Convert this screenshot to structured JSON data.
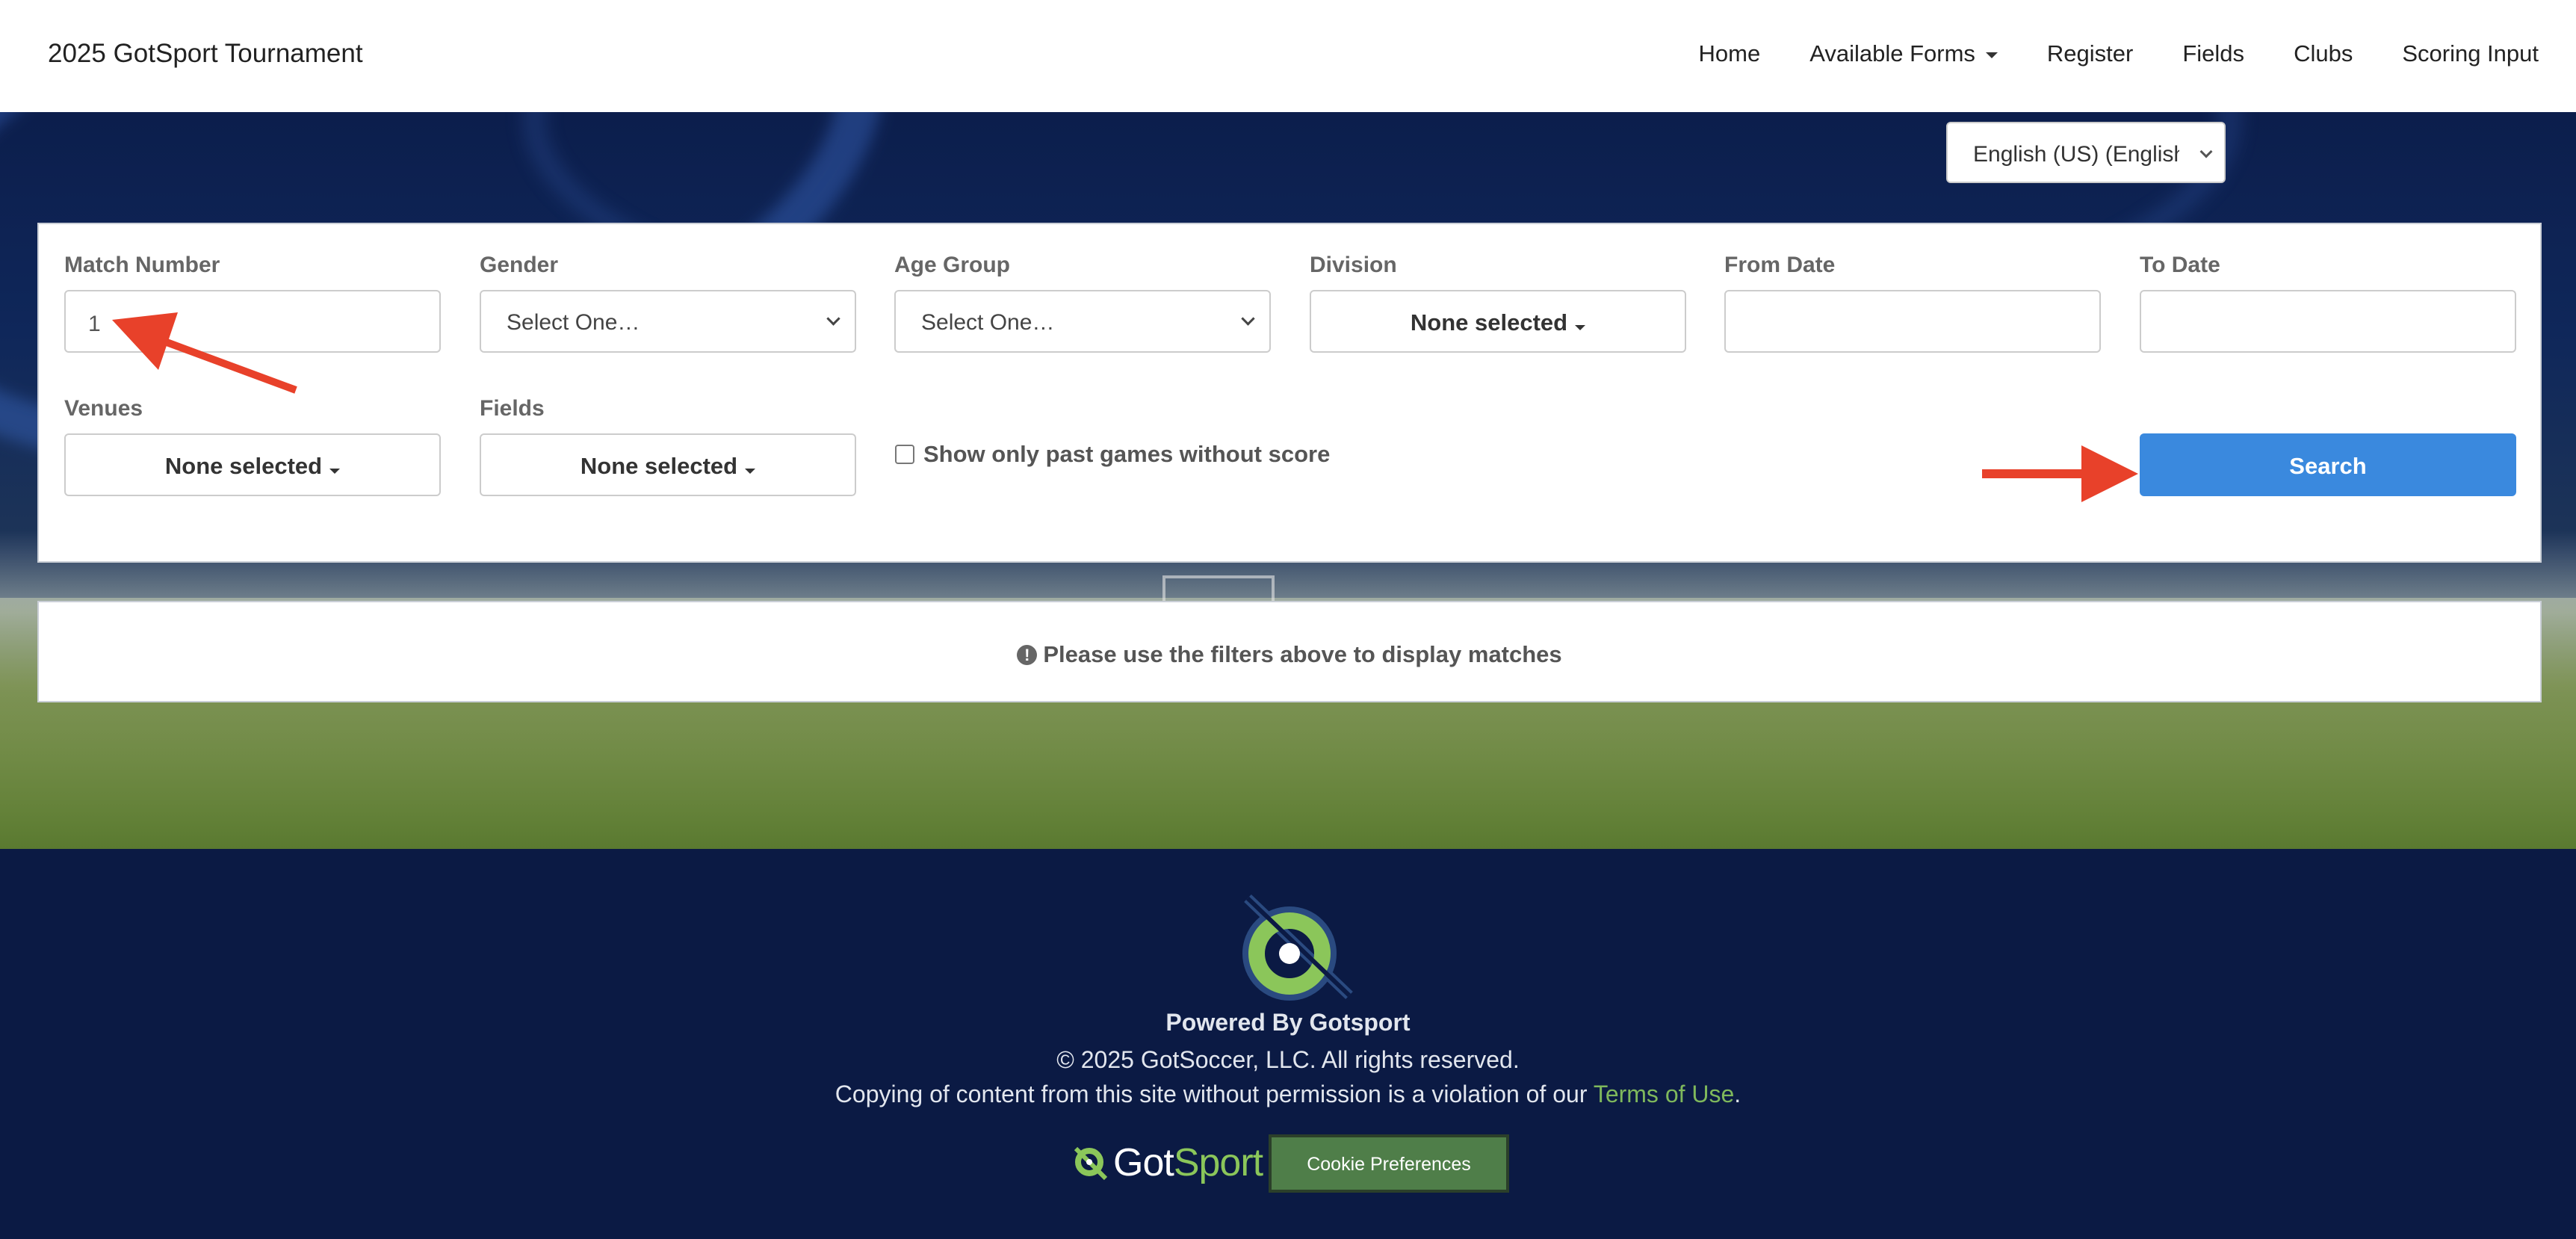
{
  "navbar": {
    "brand": "2025 GotSport Tournament",
    "items": [
      {
        "label": "Home",
        "has_dropdown": false
      },
      {
        "label": "Available Forms",
        "has_dropdown": true
      },
      {
        "label": "Register",
        "has_dropdown": false
      },
      {
        "label": "Fields",
        "has_dropdown": false
      },
      {
        "label": "Clubs",
        "has_dropdown": false
      },
      {
        "label": "Scoring Input",
        "has_dropdown": false
      }
    ]
  },
  "language": {
    "selected": "English (US) (English"
  },
  "filters": {
    "match_number": {
      "label": "Match Number",
      "value": "1"
    },
    "gender": {
      "label": "Gender",
      "selected": "Select One…"
    },
    "age_group": {
      "label": "Age Group",
      "selected": "Select One…"
    },
    "division": {
      "label": "Division",
      "selected": "None selected"
    },
    "from_date": {
      "label": "From Date",
      "value": ""
    },
    "to_date": {
      "label": "To Date",
      "value": ""
    },
    "venues": {
      "label": "Venues",
      "selected": "None selected"
    },
    "fields": {
      "label": "Fields",
      "selected": "None selected"
    },
    "past_games_checkbox": {
      "label": "Show only past games without score",
      "checked": false
    },
    "search_label": "Search"
  },
  "message": {
    "icon": "exclamation-circle-icon",
    "text": "Please use the filters above to display matches"
  },
  "footer": {
    "powered_by": "Powered By Gotsport",
    "copyright": "© 2025 GotSoccer, LLC. All rights reserved.",
    "copying_prefix": "Copying of content from this site without permission is a violation of our ",
    "terms_link": "Terms of Use",
    "copying_suffix": ".",
    "logo_got": "Got",
    "logo_sport": "Sport",
    "cookie_button": "Cookie Preferences"
  },
  "colors": {
    "primary_button": "#3a89de",
    "footer_bg": "#0b1a44",
    "brand_green": "#8bc65a",
    "cookie_button": "#4f7e49",
    "annotation_arrow": "#e8412a"
  }
}
